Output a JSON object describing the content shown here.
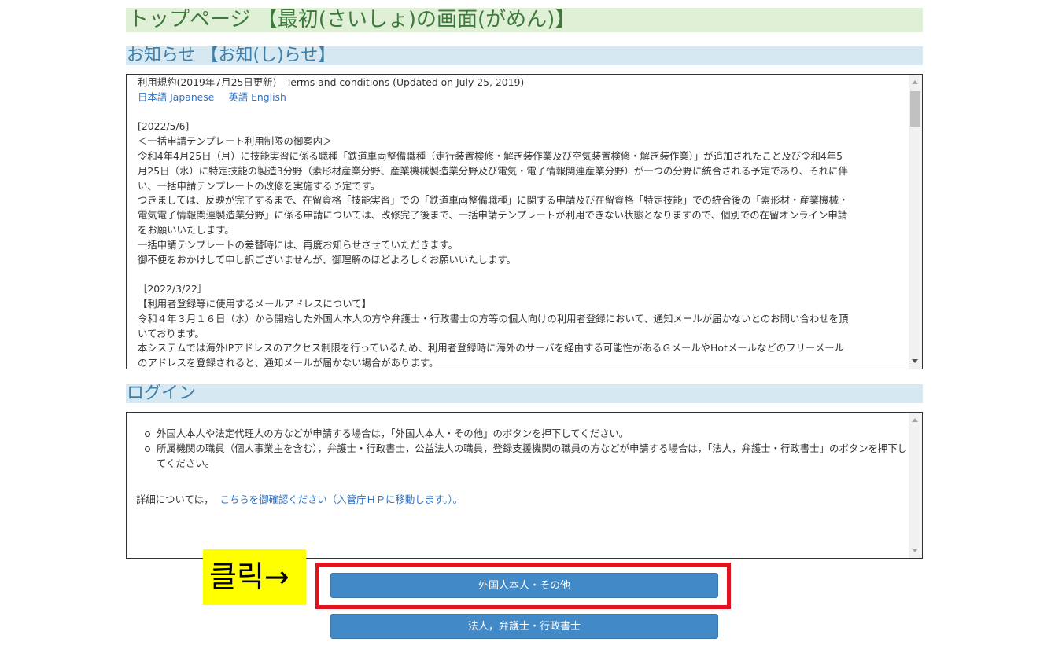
{
  "page_title": "トップページ 【最初(さいしょ)の画面(がめん)】",
  "notice": {
    "title": "お知らせ 【お知(し)らせ】",
    "terms_line": "利用規約(2019年7月25日更新)　Terms and conditions (Updated on July 25, 2019)",
    "links": [
      "日本語 Japanese",
      "英語 English"
    ],
    "lines_block1": [
      "[2022/5/6]",
      "＜一括申請テンプレート利用制限の御案内＞",
      "令和4年4月25日（月）に技能実習に係る職種「鉄道車両整備職種（走行装置検修・解ぎ装作業及び空気装置検修・解ぎ装作業）」が追加されたこと及び令和4年5",
      "月25日（水）に特定技能の製造3分野（素形材産業分野、産業機械製造業分野及び電気・電子情報関連産業分野）が一つの分野に統合される予定であり、それに伴",
      "い、一括申請テンプレートの改修を実施する予定です。",
      "つきましては、反映が完了するまで、在留資格「技能実習」での「鉄道車両整備職種」に関する申請及び在留資格「特定技能」での統合後の「素形材・産業機械・",
      "電気電子情報関連製造業分野」に係る申請については、改修完了後まで、一括申請テンプレートが利用できない状態となりますので、個別での在留オンライン申請",
      "をお願いいたします。",
      "一括申請テンプレートの差替時には、再度お知らせさせていただきます。",
      "御不便をおかけして申し訳ございませんが、御理解のほどよろしくお願いいたします。"
    ],
    "lines_block2": [
      "［2022/3/22］",
      "【利用者登録等に使用するメールアドレスについて】",
      "令和４年３月１６日（水）から開始した外国人本人の方や弁護士・行政書士の方等の個人向けの利用者登録において、通知メールが届かないとのお問い合わせを頂",
      "いております。",
      "本システムでは海外IPアドレスのアクセス制限を行っているため、利用者登録時に海外のサーバを経由する可能性があるＧメールやHotメールなどのフリーメール",
      "のアドレスを登録されると、通知メールが届かない場合があります。"
    ]
  },
  "login": {
    "title": "ログイン",
    "items": [
      "外国人本人や法定代理人の方などが申請する場合は，「外国人本人・その他」のボタンを押下してください。",
      "所属機関の職員（個人事業主を含む），弁護士・行政書士，公益法人の職員，登録支援機関の職員の方などが申請する場合は，「法人，弁護士・行政書士」のボタンを押下してください。"
    ],
    "detail_prefix": "詳細については，",
    "detail_link": "こちらを御確認ください（入管庁ＨＰに移動します。）。"
  },
  "annotation": {
    "click_label": "클릭→",
    "highlight_color": "#e0141e",
    "label_bg": "#ffff00"
  },
  "buttons": {
    "foreign": "外国人本人・その他",
    "corporate": "法人，弁護士・行政書士"
  },
  "colors": {
    "button_bg": "#4189c7",
    "page_title_bg": "#e0f0d6",
    "section_title_bg": "#d6e9f3",
    "link": "#2f73c4"
  }
}
